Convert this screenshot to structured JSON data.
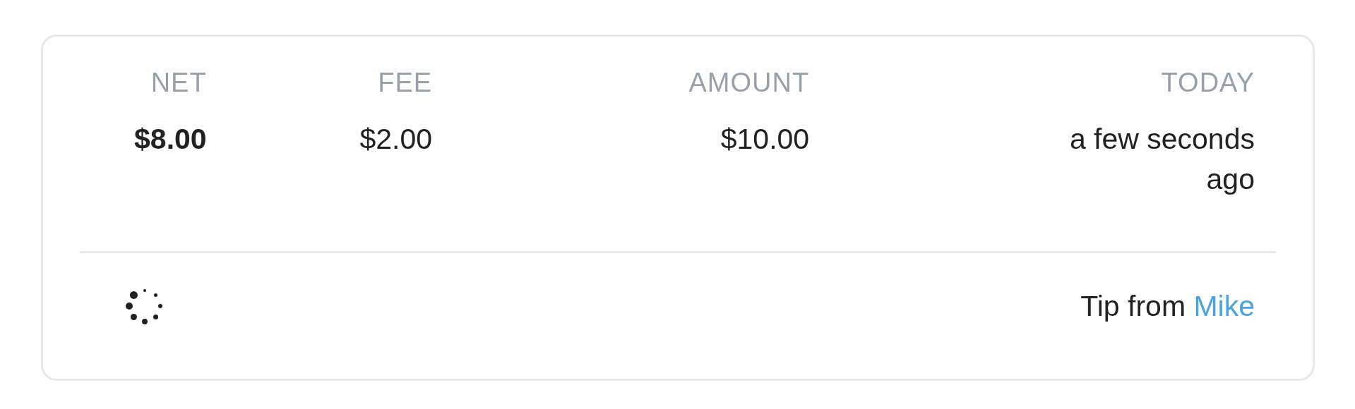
{
  "columns": [
    {
      "header": "NET",
      "value": "$8.00",
      "bold": true
    },
    {
      "header": "FEE",
      "value": "$2.00",
      "bold": false
    },
    {
      "header": "AMOUNT",
      "value": "$10.00",
      "bold": false
    },
    {
      "header": "TODAY",
      "value": "a few seconds ago",
      "bold": false
    }
  ],
  "loading": true,
  "description": {
    "text": "Tip from ",
    "link": "Mike"
  }
}
